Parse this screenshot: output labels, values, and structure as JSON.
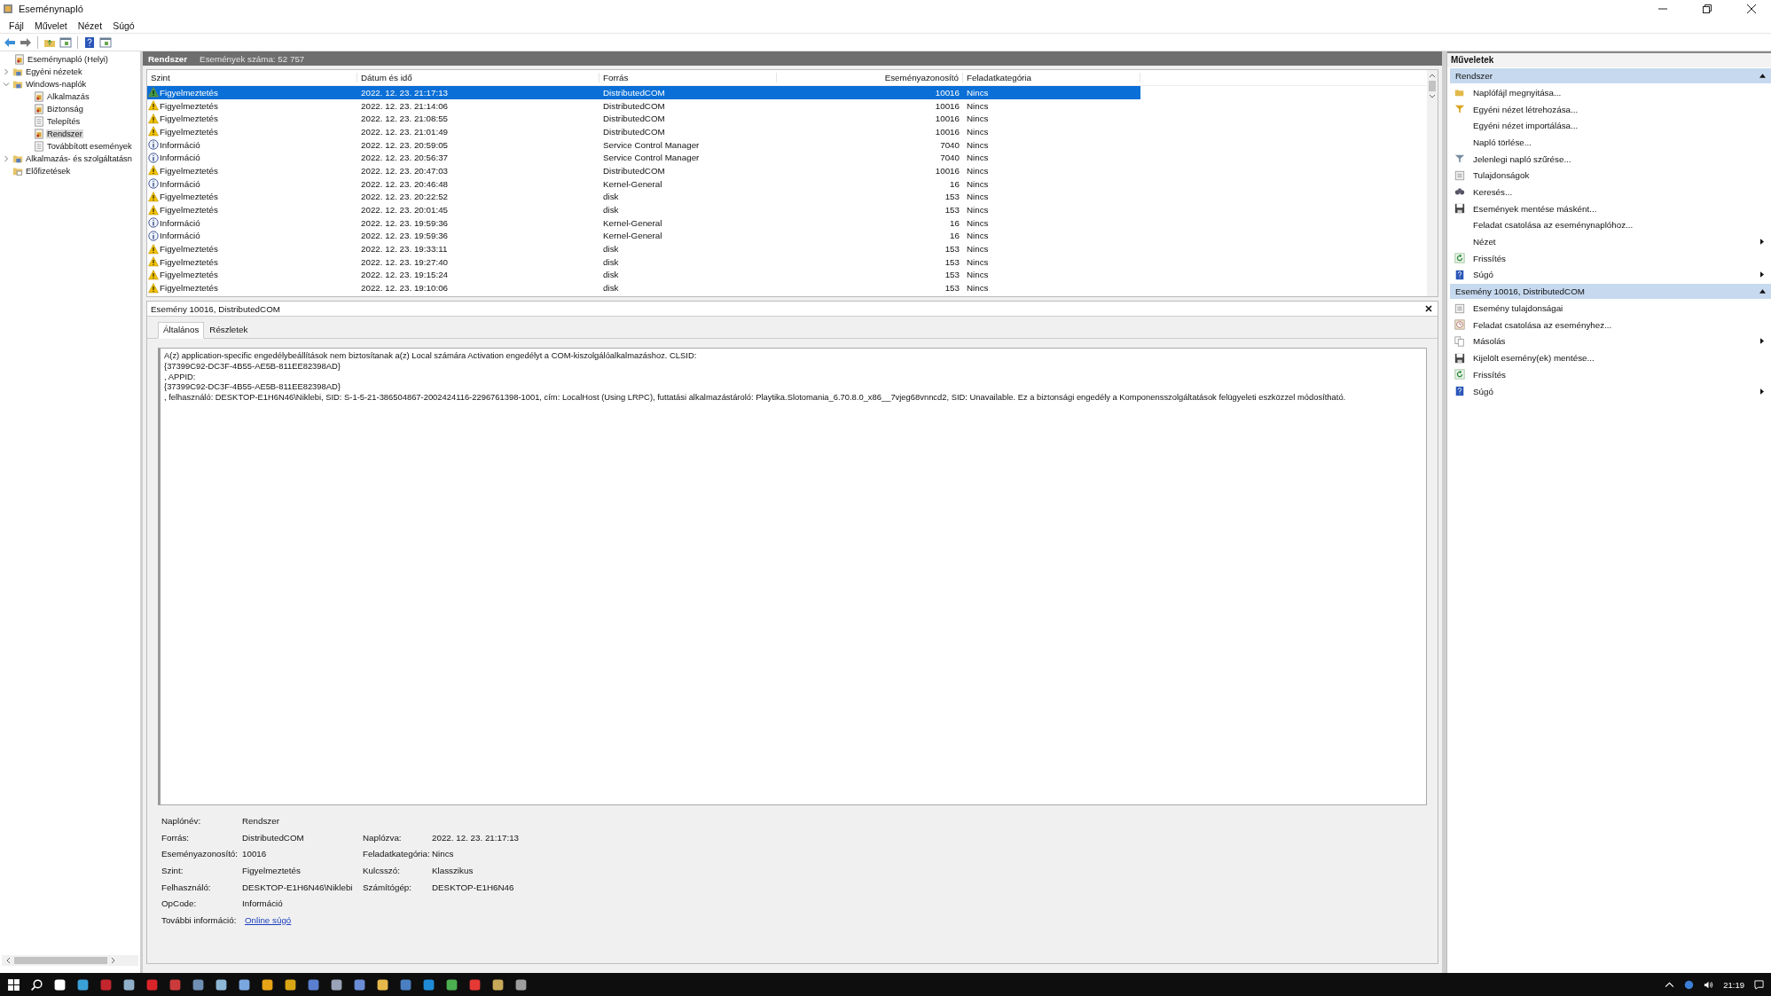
{
  "window": {
    "title": "Eseménynapló"
  },
  "menu": [
    "Fájl",
    "Művelet",
    "Nézet",
    "Súgó"
  ],
  "toolbar": [
    {
      "kind": "back"
    },
    {
      "kind": "forward"
    },
    {
      "kind": "folder"
    },
    {
      "kind": "panel"
    },
    {
      "kind": "help"
    },
    {
      "kind": "panel"
    }
  ],
  "tree": [
    {
      "label": "Eseménynapló (Helyi)",
      "kind": "root",
      "selected": false,
      "children": [
        {
          "label": "Egyéni nézetek",
          "kind": "folder",
          "selected": false,
          "expanded": false
        },
        {
          "label": "Windows-naplók",
          "kind": "folder",
          "selected": false,
          "expanded": true,
          "children": [
            {
              "label": "Alkalmazás",
              "kind": "log",
              "selected": false
            },
            {
              "label": "Biztonság",
              "kind": "log",
              "selected": false
            },
            {
              "label": "Telepítés",
              "kind": "page",
              "selected": false
            },
            {
              "label": "Rendszer",
              "kind": "log",
              "selected": true
            },
            {
              "label": "Továbbított események",
              "kind": "page",
              "selected": false
            }
          ]
        },
        {
          "label": "Alkalmazás- és szolgáltatásn",
          "kind": "folder",
          "selected": false,
          "expanded": false
        },
        {
          "label": "Előfizetések",
          "kind": "subscription",
          "selected": false
        }
      ]
    }
  ],
  "log_header": {
    "title": "Rendszer",
    "count": "Események száma: 52 757"
  },
  "table": {
    "columns": [
      "Szint",
      "Dátum és idő",
      "Forrás",
      "Eseményazonosító",
      "Feladatkategória"
    ],
    "rows": [
      {
        "kind": "warning",
        "level": "Figyelmeztetés",
        "date": "2022. 12. 23. 21:17:13",
        "source": "DistributedCOM",
        "id": "10016",
        "category": "Nincs",
        "selected": true
      },
      {
        "kind": "warning",
        "level": "Figyelmeztetés",
        "date": "2022. 12. 23. 21:14:06",
        "source": "DistributedCOM",
        "id": "10016",
        "category": "Nincs",
        "selected": false
      },
      {
        "kind": "warning",
        "level": "Figyelmeztetés",
        "date": "2022. 12. 23. 21:08:55",
        "source": "DistributedCOM",
        "id": "10016",
        "category": "Nincs",
        "selected": false
      },
      {
        "kind": "warning",
        "level": "Figyelmeztetés",
        "date": "2022. 12. 23. 21:01:49",
        "source": "DistributedCOM",
        "id": "10016",
        "category": "Nincs",
        "selected": false
      },
      {
        "kind": "info",
        "level": "Információ",
        "date": "2022. 12. 23. 20:59:05",
        "source": "Service Control Manager",
        "id": "7040",
        "category": "Nincs",
        "selected": false
      },
      {
        "kind": "info",
        "level": "Információ",
        "date": "2022. 12. 23. 20:56:37",
        "source": "Service Control Manager",
        "id": "7040",
        "category": "Nincs",
        "selected": false
      },
      {
        "kind": "warning",
        "level": "Figyelmeztetés",
        "date": "2022. 12. 23. 20:47:03",
        "source": "DistributedCOM",
        "id": "10016",
        "category": "Nincs",
        "selected": false
      },
      {
        "kind": "info",
        "level": "Információ",
        "date": "2022. 12. 23. 20:46:48",
        "source": "Kernel-General",
        "id": "16",
        "category": "Nincs",
        "selected": false
      },
      {
        "kind": "warning",
        "level": "Figyelmeztetés",
        "date": "2022. 12. 23. 20:22:52",
        "source": "disk",
        "id": "153",
        "category": "Nincs",
        "selected": false
      },
      {
        "kind": "warning",
        "level": "Figyelmeztetés",
        "date": "2022. 12. 23. 20:01:45",
        "source": "disk",
        "id": "153",
        "category": "Nincs",
        "selected": false
      },
      {
        "kind": "info",
        "level": "Információ",
        "date": "2022. 12. 23. 19:59:36",
        "source": "Kernel-General",
        "id": "16",
        "category": "Nincs",
        "selected": false
      },
      {
        "kind": "info",
        "level": "Információ",
        "date": "2022. 12. 23. 19:59:36",
        "source": "Kernel-General",
        "id": "16",
        "category": "Nincs",
        "selected": false
      },
      {
        "kind": "warning",
        "level": "Figyelmeztetés",
        "date": "2022. 12. 23. 19:33:11",
        "source": "disk",
        "id": "153",
        "category": "Nincs",
        "selected": false
      },
      {
        "kind": "warning",
        "level": "Figyelmeztetés",
        "date": "2022. 12. 23. 19:27:40",
        "source": "disk",
        "id": "153",
        "category": "Nincs",
        "selected": false
      },
      {
        "kind": "warning",
        "level": "Figyelmeztetés",
        "date": "2022. 12. 23. 19:15:24",
        "source": "disk",
        "id": "153",
        "category": "Nincs",
        "selected": false
      },
      {
        "kind": "warning",
        "level": "Figyelmeztetés",
        "date": "2022. 12. 23. 19:10:06",
        "source": "disk",
        "id": "153",
        "category": "Nincs",
        "selected": false
      }
    ]
  },
  "detail": {
    "title": "Esemény 10016, DistributedCOM",
    "tabs": [
      {
        "label": "Általános",
        "selected": true
      },
      {
        "label": "Részletek",
        "selected": false
      }
    ],
    "message": "A(z) application-specific engedélybeállítások nem biztosítanak a(z) Local számára Activation engedélyt a COM-kiszolgálóalkalmazáshoz. CLSID: \n{37399C92-DC3F-4B55-AE5B-811EE82398AD}\n, APPID: \n{37399C92-DC3F-4B55-AE5B-811EE82398AD}\n, felhasználó: DESKTOP-E1H6N46\\Niklebi, SID: S-1-5-21-386504867-2002424116-2296761398-1001, cím: LocalHost (Using LRPC), futtatási alkalmazástároló: Playtika.Slotomania_6.70.8.0_x86__7vjeg68vnncd2, SID: Unavailable. Ez a biztonsági engedély a Komponensszolgáltatások felügyeleti eszközzel módosítható.",
    "fields": [
      {
        "label": "Naplónév:",
        "value": "Rendszer"
      },
      {
        "label": "Forrás:",
        "value": "DistributedCOM",
        "label2": "Naplózva:",
        "value2": "2022. 12. 23. 21:17:13"
      },
      {
        "label": "Eseményazonosító:",
        "value": "10016",
        "label2": "Feladatkategória:",
        "value2": "Nincs"
      },
      {
        "label": "Szint:",
        "value": "Figyelmeztetés",
        "label2": "Kulcsszó:",
        "value2": "Klasszikus"
      },
      {
        "label": "Felhasználó:",
        "value": "DESKTOP-E1H6N46\\Niklebi",
        "label2": "Számítógép:",
        "value2": "DESKTOP-E1H6N46"
      },
      {
        "label": "OpCode:",
        "value": "Információ"
      },
      {
        "label": "További információ:",
        "link": "Online súgó"
      }
    ]
  },
  "actions": {
    "title": "Műveletek",
    "sections": [
      {
        "title": "Rendszer",
        "expanded": true,
        "items": [
          {
            "label": "Naplófájl megnyitása...",
            "kind": "open"
          },
          {
            "label": "Egyéni nézet létrehozása...",
            "kind": "filter"
          },
          {
            "label": "Egyéni nézet importálása...",
            "kind": "plain"
          },
          {
            "label": "Napló törlése...",
            "kind": "plain"
          },
          {
            "label": "Jelenlegi napló szűrése...",
            "kind": "filtergrey"
          },
          {
            "label": "Tulajdonságok",
            "kind": "props"
          },
          {
            "label": "Keresés...",
            "kind": "find"
          },
          {
            "label": "Események mentése másként...",
            "kind": "save"
          },
          {
            "label": "Feladat csatolása az eseménynaplóhoz...",
            "kind": "plain"
          },
          {
            "label": "Nézet",
            "kind": "plain",
            "submenu": true
          },
          {
            "label": "Frissítés",
            "kind": "refresh"
          },
          {
            "label": "Súgó",
            "kind": "help",
            "submenu": true
          }
        ]
      },
      {
        "title": "Esemény 10016, DistributedCOM",
        "expanded": true,
        "items": [
          {
            "label": "Esemény tulajdonságai",
            "kind": "props"
          },
          {
            "label": "Feladat csatolása az eseményhez...",
            "kind": "task"
          },
          {
            "label": "Másolás",
            "kind": "copy",
            "submenu": true
          },
          {
            "label": "Kijelölt esemény(ek) mentése...",
            "kind": "save"
          },
          {
            "label": "Frissítés",
            "kind": "refresh"
          },
          {
            "label": "Súgó",
            "kind": "help",
            "submenu": true
          }
        ]
      }
    ]
  },
  "taskbar": {
    "apps": [
      {
        "color": "#ffffff"
      },
      {
        "color": "#3aa0d8"
      },
      {
        "color": "#c4262e"
      },
      {
        "color": "#8fb0c8"
      },
      {
        "color": "#d9252a"
      },
      {
        "color": "#cc3b3b"
      },
      {
        "color": "#6f8fb3"
      },
      {
        "color": "#8eb7d6"
      },
      {
        "color": "#7aa7e0"
      },
      {
        "color": "#e8a317"
      },
      {
        "color": "#d9a514"
      },
      {
        "color": "#5b7fd0"
      },
      {
        "color": "#9aa3b8"
      },
      {
        "color": "#6b8dd6"
      },
      {
        "color": "#e7b94b"
      },
      {
        "color": "#4a7fc1"
      },
      {
        "color": "#1f8bd6"
      },
      {
        "color": "#4caf50"
      },
      {
        "color": "#e53935"
      },
      {
        "color": "#c8a95a"
      },
      {
        "color": "#9e9e9e"
      }
    ],
    "clock": "21:19"
  }
}
